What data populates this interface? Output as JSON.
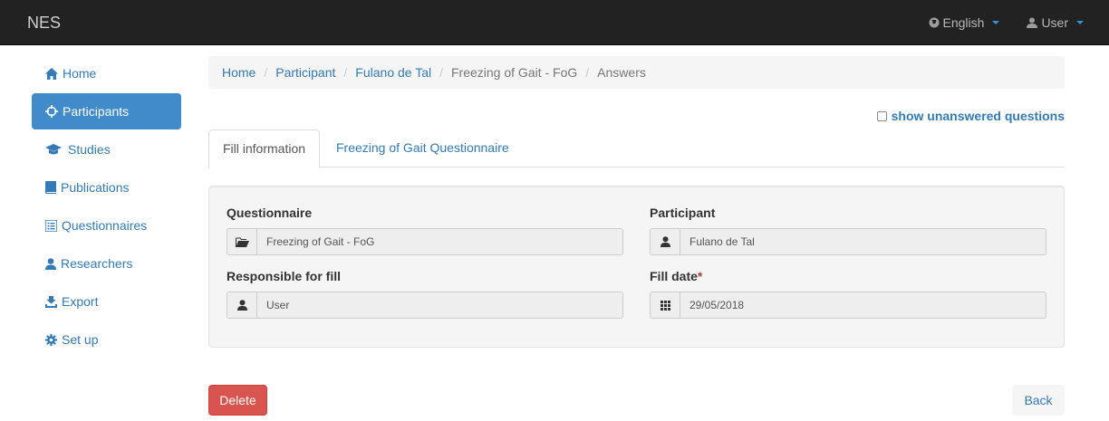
{
  "navbar": {
    "brand": "NES",
    "language": {
      "label": "English",
      "icon": "globe-icon"
    },
    "user": {
      "label": "User",
      "icon": "user-icon"
    }
  },
  "sidebar": {
    "items": [
      {
        "label": "Home",
        "icon": "home-icon",
        "active": false
      },
      {
        "label": "Participants",
        "icon": "participants-icon",
        "active": true
      },
      {
        "label": "Studies",
        "icon": "graduation-cap-icon",
        "active": false
      },
      {
        "label": "Publications",
        "icon": "book-icon",
        "active": false
      },
      {
        "label": "Questionnaires",
        "icon": "list-icon",
        "active": false
      },
      {
        "label": "Researchers",
        "icon": "user-icon",
        "active": false
      },
      {
        "label": "Export",
        "icon": "export-icon",
        "active": false
      },
      {
        "label": "Set up",
        "icon": "gear-icon",
        "active": false
      }
    ]
  },
  "breadcrumb": {
    "items": [
      "Home",
      "Participant",
      "Fulano de Tal"
    ],
    "current": [
      "Freezing of Gait - FoG",
      "Answers"
    ]
  },
  "options": {
    "show_unanswered": "show unanswered questions"
  },
  "tabs": [
    {
      "label": "Fill information",
      "active": true
    },
    {
      "label": "Freezing of Gait Questionnaire",
      "active": false
    }
  ],
  "form": {
    "questionnaire": {
      "label": "Questionnaire",
      "value": "Freezing of Gait - FoG",
      "icon": "folder-open-icon"
    },
    "participant": {
      "label": "Participant",
      "value": "Fulano de Tal",
      "icon": "user-icon"
    },
    "responsible": {
      "label": "Responsible for fill",
      "value": "User",
      "icon": "user-icon"
    },
    "fill_date": {
      "label": "Fill date",
      "required_mark": "*",
      "value": "29/05/2018",
      "icon": "calendar-icon"
    }
  },
  "actions": {
    "delete": "Delete",
    "back": "Back"
  },
  "colors": {
    "navbar_bg": "#222222",
    "link": "#337ab7",
    "active_sidebar": "#428bca",
    "danger": "#d9534f"
  }
}
